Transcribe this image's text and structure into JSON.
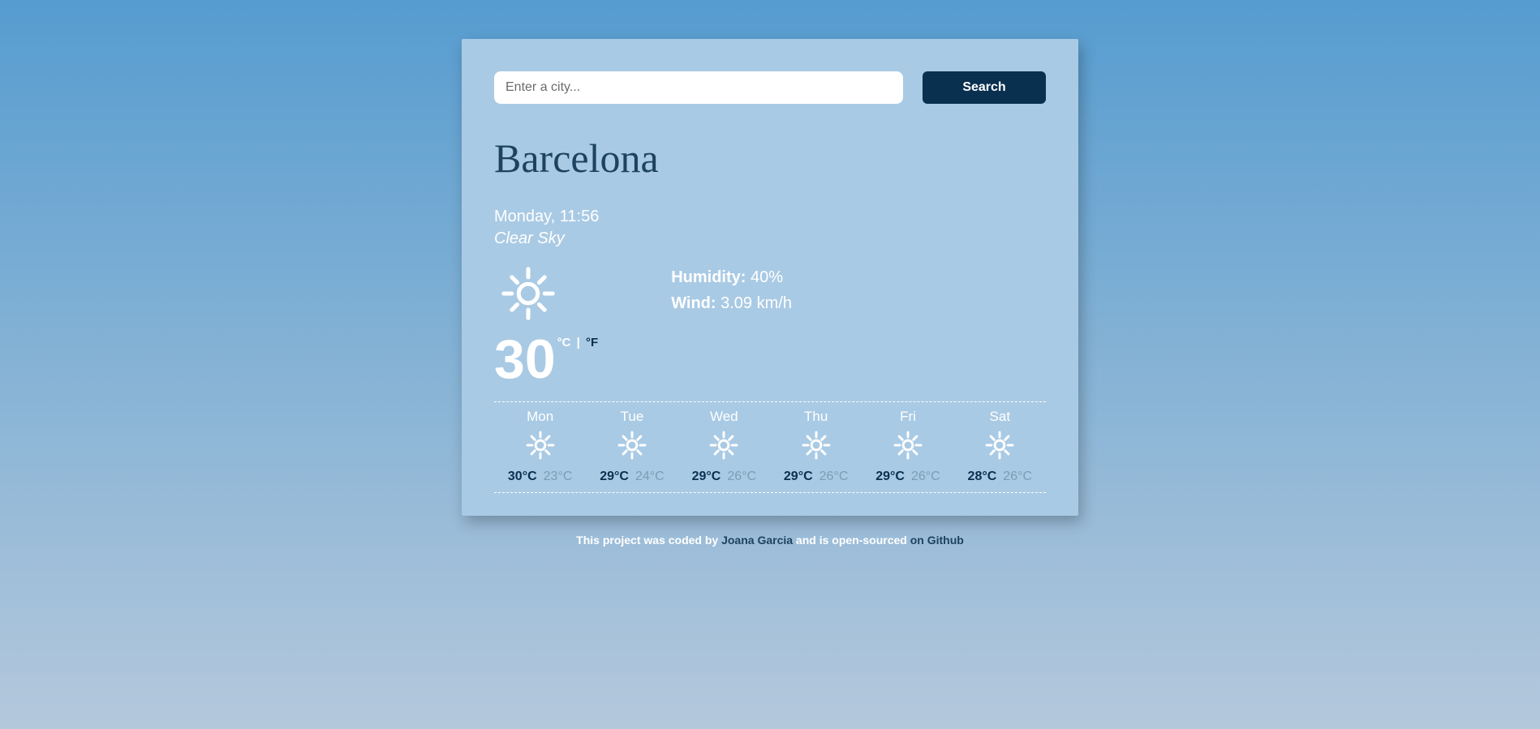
{
  "search": {
    "placeholder": "Enter a city...",
    "button": "Search"
  },
  "city": "Barcelona",
  "datetime": "Monday, 11:56",
  "condition": "Clear Sky",
  "temperature": "30",
  "unit_c": "°C",
  "unit_sep": " | ",
  "unit_f": "°F",
  "stats": {
    "humidity_label": "Humidity:",
    "humidity_value": " 40%",
    "wind_label": "Wind:",
    "wind_value": " 3.09 km/h"
  },
  "forecast": [
    {
      "label": "Mon",
      "hi": "30°C",
      "lo": "23°C"
    },
    {
      "label": "Tue",
      "hi": "29°C",
      "lo": "24°C"
    },
    {
      "label": "Wed",
      "hi": "29°C",
      "lo": "26°C"
    },
    {
      "label": "Thu",
      "hi": "29°C",
      "lo": "26°C"
    },
    {
      "label": "Fri",
      "hi": "29°C",
      "lo": "26°C"
    },
    {
      "label": "Sat",
      "hi": "28°C",
      "lo": "26°C"
    }
  ],
  "footer": {
    "pre": "This project was coded by ",
    "author": "Joana Garcia",
    "mid": " and is open-sourced ",
    "link": "on Github"
  }
}
